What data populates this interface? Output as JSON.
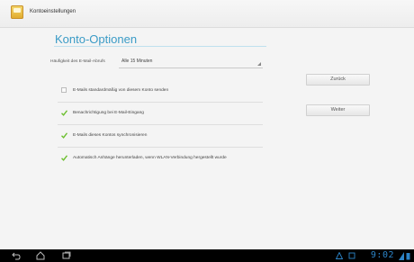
{
  "header": {
    "title": "Kontoeinstellungen",
    "icon": "app-icon"
  },
  "page": {
    "title": "Konto-Optionen"
  },
  "frequency": {
    "label": "Häufigkeit des E-Mail-Abrufs",
    "value": "Alle 15 Minuten"
  },
  "options": [
    {
      "label": "E-Mails standardmäßig von diesem Konto senden",
      "checked": false
    },
    {
      "label": "Benachrichtigung bei E-Mail-Eingang",
      "checked": true
    },
    {
      "label": "E-Mails dieses Kontos synchronisieren",
      "checked": true
    },
    {
      "label": "Automatisch Anhänge herunterladen, wenn WLAN-Verbindung hergestellt wurde",
      "checked": true
    }
  ],
  "buttons": {
    "back": "Zurück",
    "next": "Weiter"
  },
  "statusbar": {
    "time": "9:02"
  },
  "colors": {
    "accent": "#3a9bc6",
    "check": "#6cbf2f"
  }
}
